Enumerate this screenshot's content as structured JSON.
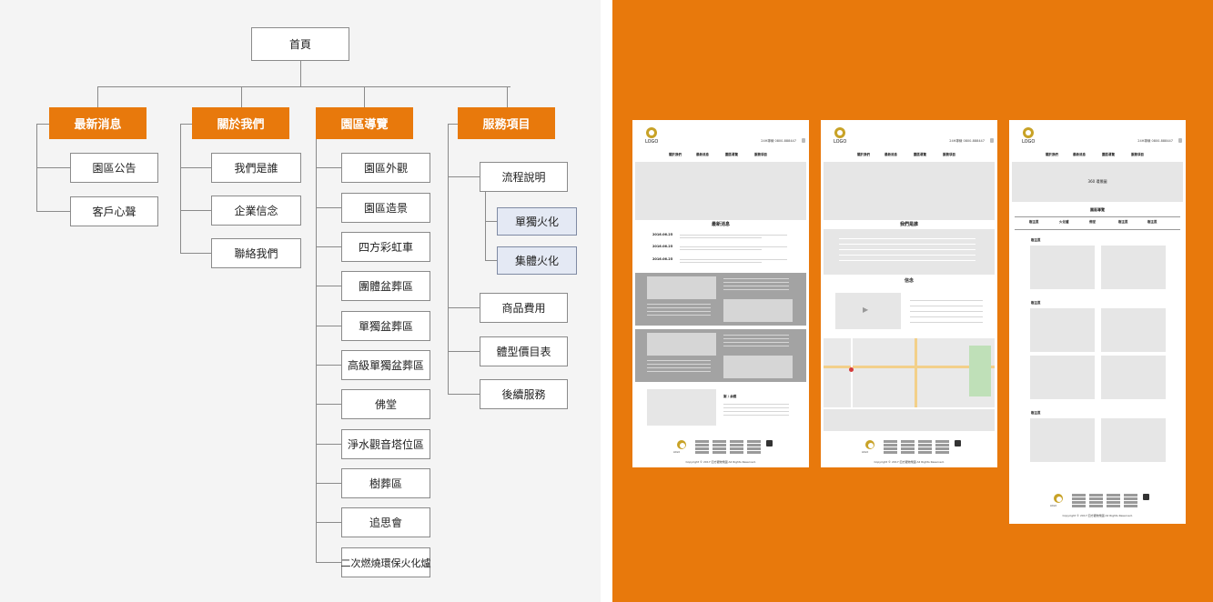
{
  "sitemap": {
    "root": "首頁",
    "categories": [
      {
        "label": "最新消息",
        "items": [
          "園區公告",
          "客戶心聲"
        ]
      },
      {
        "label": "關於我們",
        "items": [
          "我們是誰",
          "企業信念",
          "聯絡我們"
        ]
      },
      {
        "label": "園區導覽",
        "items": [
          "園區外觀",
          "園區造景",
          "四方彩虹車",
          "團體盆葬區",
          "單獨盆葬區",
          "高級單獨盆葬區",
          "佛堂",
          "淨水觀音塔位區",
          "樹葬區",
          "追思會",
          "二次燃燒環保火化爐"
        ]
      },
      {
        "label": "服務項目",
        "items": [
          "流程說明",
          "商品費用",
          "體型價目表",
          "後續服務"
        ],
        "subitems": [
          "單獨火化",
          "集體火化"
        ]
      }
    ]
  },
  "wireframes": {
    "colors": {
      "accent": "#e8790c",
      "logo": "#c8a227"
    },
    "logo_text": "LOGO",
    "phone": "24H專線 0800-888447",
    "nav": [
      "關於我們",
      "最新消息",
      "園區導覽",
      "服務項目"
    ],
    "copyright": "Copyright © 2017 四方寵物樂園 All Rights Reserved.",
    "page1": {
      "section_title": "最新消息",
      "dates": [
        "2016.06.25",
        "2016.06.25",
        "2016.06.25"
      ],
      "customer_label": "謝 / 余蝶"
    },
    "page2": {
      "section1_title": "我們是誰",
      "section2_title": "信念"
    },
    "page3": {
      "hero_text": "360 環景圖",
      "section_title": "園區導覽",
      "tabs": [
        "樹主區",
        "火化爐",
        "佛堂",
        "樹主區",
        "樹主區"
      ],
      "group_labels": [
        "樹主區",
        "樹主區",
        "樹主區"
      ]
    }
  }
}
